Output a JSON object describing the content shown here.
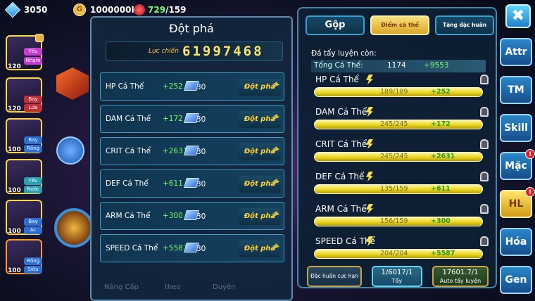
{
  "topbar": {
    "gems": "3050",
    "coin_symbol": "G",
    "gold": "1000000k",
    "stamina": "729",
    "stamina_max": "/159"
  },
  "roster": [
    {
      "level": "120",
      "tag": "Yếu",
      "tag2": "Nhạm",
      "color": "tagp"
    },
    {
      "level": "120",
      "tag": "Bay",
      "tag2": "Lửa",
      "color": "tagr"
    },
    {
      "level": "100",
      "tag": "Bay",
      "tag2": "Rồng",
      "color": "tagb"
    },
    {
      "level": "100",
      "tag": "Yếu",
      "tag2": "Nước",
      "color": "tagt"
    },
    {
      "level": "100",
      "tag": "Bay",
      "tag2": "Ác",
      "color": "tagb"
    },
    {
      "level": "100",
      "tag": "Rồng",
      "tag2": "Siêu",
      "color": "tagb"
    }
  ],
  "left_panel": {
    "title": "Đột phá",
    "power_label": "Lực chiến",
    "power_value": "61997468",
    "rows": [
      {
        "name": "HP Cá Thể",
        "bonus": "+252",
        "cost": "30",
        "button": "Đột phá"
      },
      {
        "name": "DAM Cá Thể",
        "bonus": "+172",
        "cost": "30",
        "button": "Đột phá"
      },
      {
        "name": "CRIT Cá Thể",
        "bonus": "+2631",
        "cost": "30",
        "button": "Đột phá"
      },
      {
        "name": "DEF Cá Thể",
        "bonus": "+611",
        "cost": "30",
        "button": "Đột phá"
      },
      {
        "name": "ARM Cá Thể",
        "bonus": "+300",
        "cost": "30",
        "button": "Đột phá"
      },
      {
        "name": "SPEED Cá Thể",
        "bonus": "+5587",
        "cost": "30",
        "button": "Đột phá"
      }
    ],
    "bottom_tabs": [
      "Nâng Cấp",
      "theo",
      "Duyên"
    ]
  },
  "right_panel": {
    "tabs": [
      "Gộp",
      "Điểm cá thể",
      "Tăng đặc huấn"
    ],
    "subtitle": "Đá tẩy luyện còn:",
    "total_label": "Tổng Cá Thể:",
    "total_value": "1174",
    "total_bonus": "+9553",
    "stats": [
      {
        "name": "HP Cá Thể",
        "current": "189/189",
        "bonus": "+252"
      },
      {
        "name": "DAM Cá Thể",
        "current": "245/245",
        "bonus": "+172"
      },
      {
        "name": "CRIT Cá Thể",
        "current": "245/245",
        "bonus": "+2631"
      },
      {
        "name": "DEF Cá Thể",
        "current": "135/159",
        "bonus": "+611"
      },
      {
        "name": "ARM Cá Thể",
        "current": "156/159",
        "bonus": "+300"
      },
      {
        "name": "SPEED Cá Thể",
        "current": "204/204",
        "bonus": "+5587"
      }
    ],
    "buttons": {
      "special": "Đặc huấn cực hạn",
      "wash_count": "1/6017/1",
      "wash_label": "Tẩy",
      "auto_count": "17601.7/1",
      "auto_label": "Auto tẩy luyện"
    }
  },
  "side_menu": [
    {
      "label": "Attr",
      "badge": ""
    },
    {
      "label": "TM",
      "badge": ""
    },
    {
      "label": "Skill",
      "badge": ""
    },
    {
      "label": "Mặc",
      "badge": "!"
    },
    {
      "label": "HL",
      "badge": "!"
    },
    {
      "label": "Hóa",
      "badge": ""
    },
    {
      "label": "Gen",
      "badge": ""
    }
  ],
  "close_symbol": "✖",
  "colors": {
    "accent": "#3a9ed0",
    "gold": "#ffd23a",
    "green": "#7df86a"
  }
}
